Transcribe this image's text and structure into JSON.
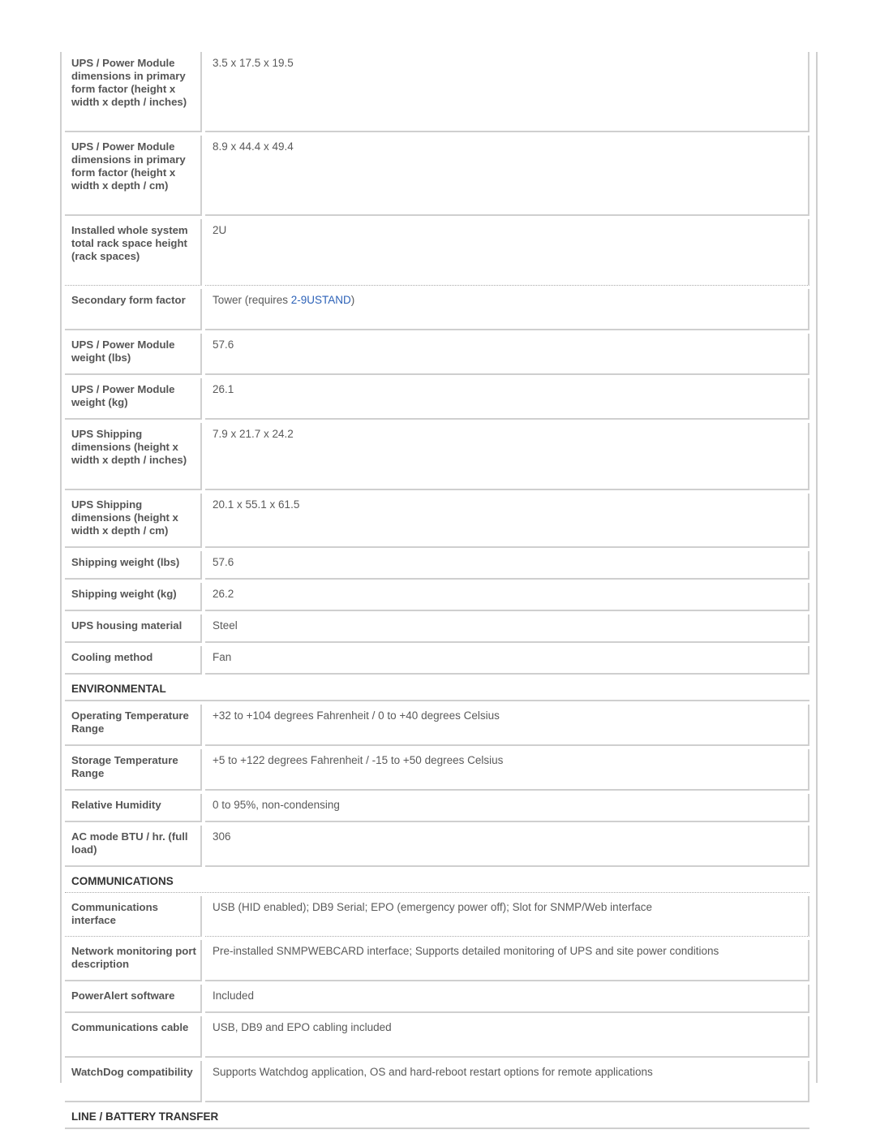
{
  "rows_top": [
    {
      "label": "UPS / Power Module dimensions in primary form factor (height x width x depth / inches)",
      "value": "3.5 x 17.5 x 19.5",
      "h": 84
    },
    {
      "label": "UPS / Power Module dimensions in primary form factor (height x width x depth / cm)",
      "value": "8.9 x 44.4 x 49.4",
      "h": 84
    },
    {
      "label": "Installed whole system total rack space height (rack spaces)",
      "value": "2U",
      "h": 68,
      "dotted": true
    },
    {
      "label": "Secondary form factor",
      "value_prefix": "Tower (requires ",
      "link": "2-9USTAND",
      "value_suffix": ")",
      "h": 36
    },
    {
      "label": "UPS / Power Module weight (lbs)",
      "value": "57.6",
      "h": 36
    },
    {
      "label": "UPS / Power Module weight (kg)",
      "value": "26.1",
      "h": 36
    },
    {
      "label": "UPS Shipping dimensions (height x width x depth / inches)",
      "value": "7.9 x 21.7 x 24.2",
      "h": 68
    },
    {
      "label": "UPS Shipping dimensions (height x width x depth / cm)",
      "value": "20.1 x 55.1 x 61.5",
      "h": 52
    },
    {
      "label": "Shipping weight (lbs)",
      "value": "57.6",
      "h": 20
    },
    {
      "label": "Shipping weight (kg)",
      "value": "26.2",
      "h": 20
    },
    {
      "label": "UPS housing material",
      "value": "Steel",
      "h": 20
    },
    {
      "label": "Cooling method",
      "value": "Fan",
      "h": 20
    }
  ],
  "sections": {
    "environmental": {
      "title": "ENVIRONMENTAL",
      "rows": [
        {
          "label": "Operating Temperature Range",
          "value": "+32 to +104 degrees Fahrenheit / 0 to +40 degrees Celsius",
          "h": 36
        },
        {
          "label": "Storage Temperature Range",
          "value": "+5 to +122 degrees Fahrenheit / -15 to +50 degrees Celsius",
          "h": 36
        },
        {
          "label": "Relative Humidity",
          "value": "0 to 95%, non-condensing",
          "h": 20
        },
        {
          "label": "AC mode BTU / hr. (full load)",
          "value": "306",
          "h": 36
        }
      ]
    },
    "communications": {
      "title": "COMMUNICATIONS",
      "rows": [
        {
          "label": "Communications interface",
          "value": "USB (HID enabled); DB9 Serial; EPO (emergency power off); Slot for SNMP/Web interface",
          "h": 36,
          "dotted": true
        },
        {
          "label": "Network monitoring port description",
          "value": "Pre-installed SNMPWEBCARD interface; Supports detailed monitoring of UPS and site power conditions",
          "h": 36
        },
        {
          "label": "PowerAlert software",
          "value": "Included",
          "h": 20
        },
        {
          "label": "Communications cable",
          "value": "USB, DB9 and EPO cabling included",
          "h": 36
        },
        {
          "label": "WatchDog compatibility",
          "value": "Supports Watchdog application, OS and hard-reboot restart options for remote applications",
          "h": 36
        }
      ]
    },
    "line_battery": {
      "title": "LINE / BATTERY TRANSFER"
    }
  }
}
